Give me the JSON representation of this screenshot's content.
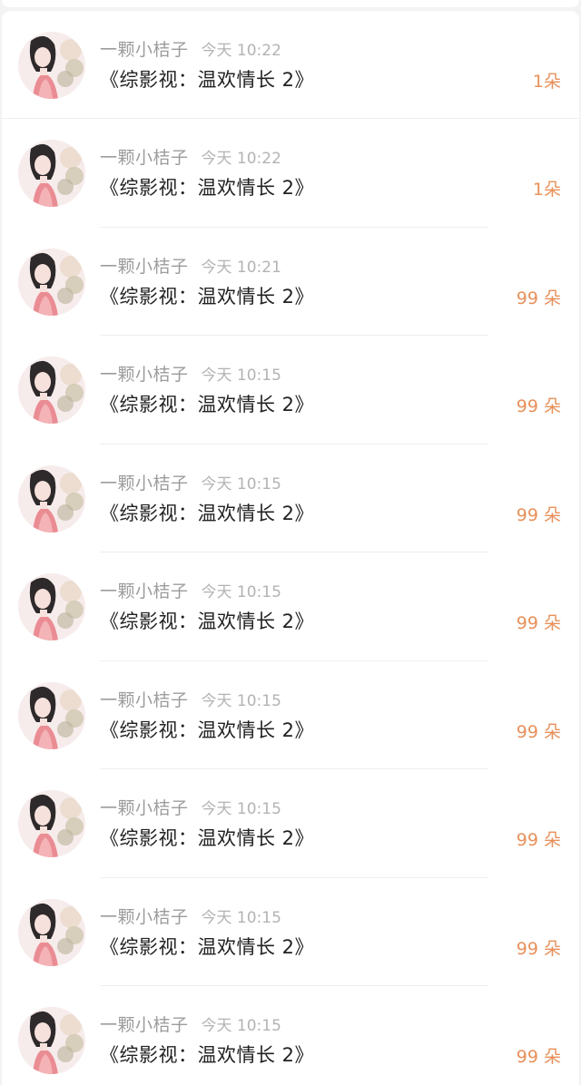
{
  "colors": {
    "accent": "#e8905a",
    "name_gray": "#9c9c9c",
    "time_gray": "#b3b3b3",
    "title_text": "#222222"
  },
  "entries": [
    {
      "user": "一颗小桔子",
      "time": "今天 10:22",
      "title": "《综影视：温欢情长 2》",
      "count": "1朵",
      "avatar_icon": "user-avatar-icon"
    },
    {
      "user": "一颗小桔子",
      "time": "今天 10:22",
      "title": "《综影视：温欢情长 2》",
      "count": "1朵",
      "avatar_icon": "user-avatar-icon"
    },
    {
      "user": "一颗小桔子",
      "time": "今天 10:21",
      "title": "《综影视：温欢情长 2》",
      "count": "99 朵",
      "avatar_icon": "user-avatar-icon"
    },
    {
      "user": "一颗小桔子",
      "time": "今天 10:15",
      "title": "《综影视：温欢情长 2》",
      "count": "99 朵",
      "avatar_icon": "user-avatar-icon"
    },
    {
      "user": "一颗小桔子",
      "time": "今天 10:15",
      "title": "《综影视：温欢情长 2》",
      "count": "99 朵",
      "avatar_icon": "user-avatar-icon"
    },
    {
      "user": "一颗小桔子",
      "time": "今天 10:15",
      "title": "《综影视：温欢情长 2》",
      "count": "99 朵",
      "avatar_icon": "user-avatar-icon"
    },
    {
      "user": "一颗小桔子",
      "time": "今天 10:15",
      "title": "《综影视：温欢情长 2》",
      "count": "99 朵",
      "avatar_icon": "user-avatar-icon"
    },
    {
      "user": "一颗小桔子",
      "time": "今天 10:15",
      "title": "《综影视：温欢情长 2》",
      "count": "99 朵",
      "avatar_icon": "user-avatar-icon"
    },
    {
      "user": "一颗小桔子",
      "time": "今天 10:15",
      "title": "《综影视：温欢情长 2》",
      "count": "99 朵",
      "avatar_icon": "user-avatar-icon"
    },
    {
      "user": "一颗小桔子",
      "time": "今天 10:15",
      "title": "《综影视：温欢情长 2》",
      "count": "99 朵",
      "avatar_icon": "user-avatar-icon"
    }
  ]
}
